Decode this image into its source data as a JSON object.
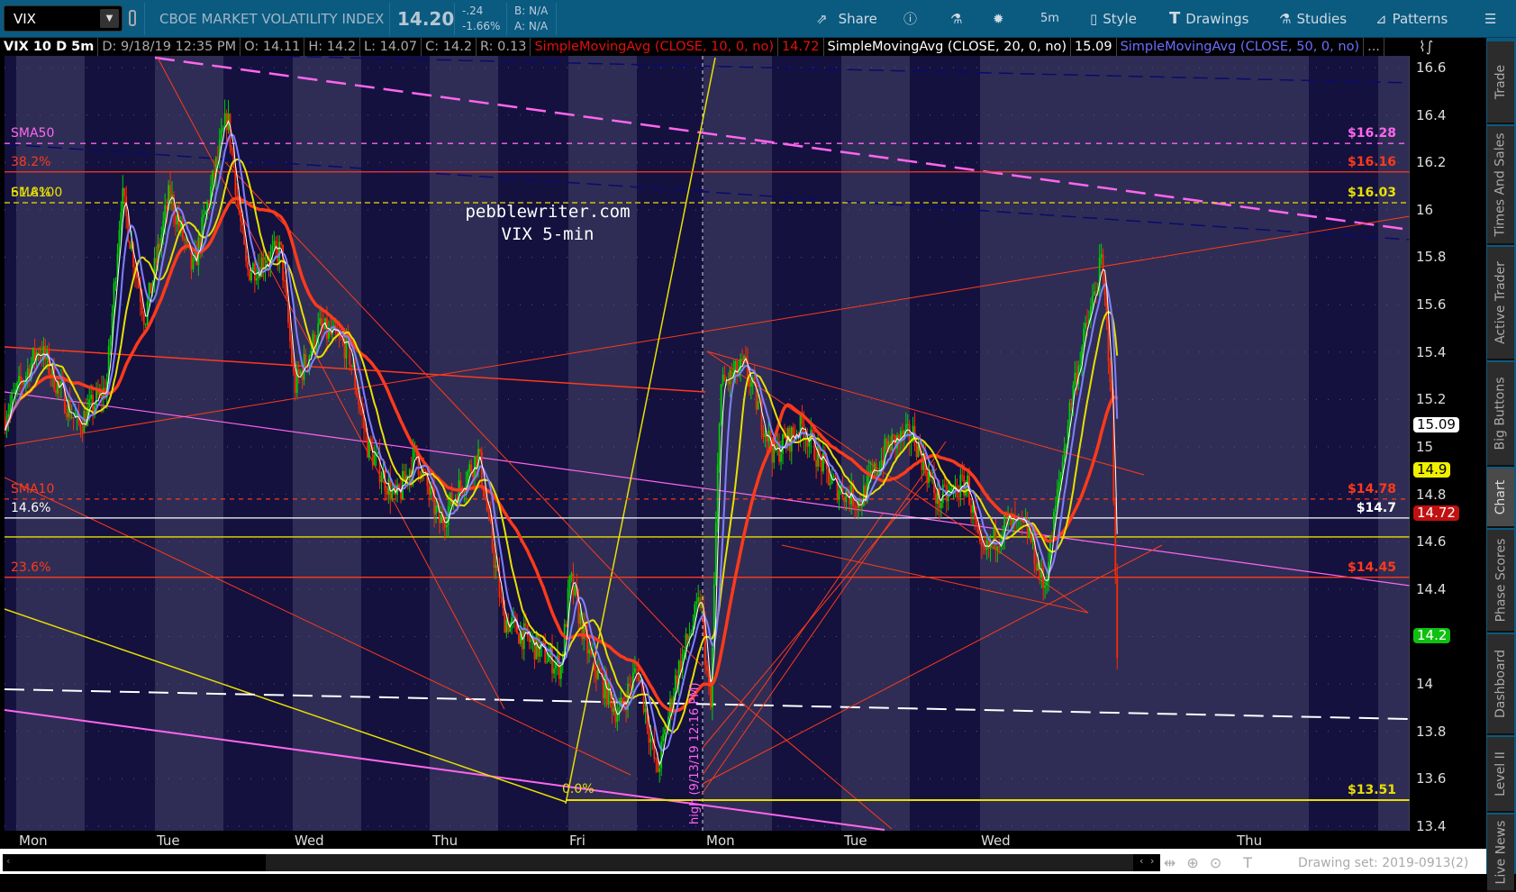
{
  "toolbar": {
    "symbol": "VIX",
    "description": "CBOE MARKET VOLATILITY INDEX",
    "last": "14.20",
    "change": "-.24",
    "change_pct": "-1.66%",
    "bid": "B: N/A",
    "ask": "A: N/A",
    "buttons": [
      {
        "label": "Share",
        "icon": "share-icon"
      },
      {
        "label": "",
        "icon": "info-icon"
      },
      {
        "label": "",
        "icon": "flask-icon"
      },
      {
        "label": "",
        "icon": "gear-icon"
      },
      {
        "label": "5m",
        "icon": ""
      },
      {
        "label": "Style",
        "icon": "candle-icon"
      },
      {
        "label": "Drawings",
        "icon": "text-t-icon"
      },
      {
        "label": "Studies",
        "icon": "flask-icon"
      },
      {
        "label": "Patterns",
        "icon": "patterns-icon"
      },
      {
        "label": "",
        "icon": "menu-icon"
      }
    ]
  },
  "info": {
    "title": "VIX 10 D 5m",
    "date": "D: 9/18/19 12:35 PM",
    "open": "O: 14.11",
    "high": "H: 14.2",
    "low": "L: 14.07",
    "close": "C: 14.2",
    "range": "R: 0.13",
    "sma10": "SimpleMovingAvg (CLOSE, 10, 0, no)",
    "sma10_val": "14.72",
    "sma20": "SimpleMovingAvg (CLOSE, 20, 0, no)",
    "sma20_val": "15.09",
    "sma50": "SimpleMovingAvg (CLOSE, 50, 0, no)",
    "more": "..."
  },
  "watermark": {
    "line1": "pebblewriter.com",
    "line2": "VIX 5-min"
  },
  "left_labels": [
    {
      "text": "SMA50",
      "color": "#ff66ee",
      "price": 16.28
    },
    {
      "text": "38.2%",
      "color": "#ff3a1a",
      "price": 16.16
    },
    {
      "text": "SMA100",
      "color": "#e8e000",
      "price": 16.03
    },
    {
      "text": "61.8%",
      "color": "#e8e000",
      "price": 16.03
    },
    {
      "text": "SMA10",
      "color": "#ff3a1a",
      "price": 14.78
    },
    {
      "text": "14.6%",
      "color": "#ffffff",
      "price": 14.7
    },
    {
      "text": "23.6%",
      "color": "#ff3a1a",
      "price": 14.45
    }
  ],
  "right_labels": [
    {
      "text": "$16.28",
      "color": "#ff66ee",
      "price": 16.28
    },
    {
      "text": "$16.16",
      "color": "#ff3a1a",
      "price": 16.16
    },
    {
      "text": "$16.03",
      "color": "#e8e000",
      "price": 16.03
    },
    {
      "text": "$14.78",
      "color": "#ff3a1a",
      "price": 14.78
    },
    {
      "text": "$14.7",
      "color": "#ffffff",
      "price": 14.7
    },
    {
      "text": "$14.45",
      "color": "#ff3a1a",
      "price": 14.45
    },
    {
      "text": "$13.51",
      "color": "#e8e000",
      "price": 13.51
    }
  ],
  "annotations": {
    "fib_zero": "0.0%",
    "high_note": "high (9/13/19 12:16 PM)"
  },
  "y_axis": {
    "ticks": [
      "16.6",
      "16.4",
      "16.2",
      "16",
      "15.8",
      "15.6",
      "15.4",
      "15.2",
      "15",
      "14.8",
      "14.6",
      "14.4",
      "14.2",
      "14",
      "13.8",
      "13.6",
      "13.4"
    ],
    "tags": [
      {
        "text": "15.09",
        "bg": "#ffffff",
        "fg": "#000000",
        "price": 15.09
      },
      {
        "text": "14.9",
        "bg": "#f0f000",
        "fg": "#000000",
        "price": 14.9
      },
      {
        "text": "14.72",
        "bg": "#c01010",
        "fg": "#ffffff",
        "price": 14.72
      },
      {
        "text": "14.2",
        "bg": "#10c010",
        "fg": "#ffffff",
        "price": 14.2
      }
    ]
  },
  "x_axis": [
    "Mon",
    "Tue",
    "Wed",
    "Thu",
    "Fri",
    "Mon",
    "Tue",
    "Wed",
    "Thu"
  ],
  "status": {
    "drawing_set": "Drawing set: 2019-0913(2)"
  },
  "sidebar": [
    "Trade",
    "Times And Sales",
    "Active Trader",
    "Big Buttons",
    "Chart",
    "Phase Scores",
    "Dashboard",
    "Level II",
    "Live News"
  ],
  "chart_data": {
    "type": "candlestick",
    "title": "VIX 10 D 5m",
    "ylim": [
      13.4,
      16.6
    ],
    "x_unit": "trading days from start",
    "price_path": [
      [
        0,
        15.13
      ],
      [
        0.25,
        15.42
      ],
      [
        0.53,
        15.09
      ],
      [
        0.74,
        15.25
      ],
      [
        0.85,
        16.07
      ],
      [
        1.02,
        15.54
      ],
      [
        1.2,
        16.07
      ],
      [
        1.37,
        15.74
      ],
      [
        1.62,
        16.4
      ],
      [
        1.76,
        15.74
      ],
      [
        2.01,
        15.83
      ],
      [
        2.11,
        15.25
      ],
      [
        2.29,
        15.5
      ],
      [
        2.5,
        15.42
      ],
      [
        2.64,
        15.01
      ],
      [
        2.85,
        14.77
      ],
      [
        2.99,
        14.97
      ],
      [
        3.17,
        14.68
      ],
      [
        3.45,
        14.97
      ],
      [
        3.63,
        14.28
      ],
      [
        3.8,
        14.19
      ],
      [
        4.05,
        14.07
      ],
      [
        4.12,
        14.44
      ],
      [
        4.26,
        14.11
      ],
      [
        4.47,
        13.87
      ],
      [
        4.61,
        14.07
      ],
      [
        4.75,
        13.62
      ],
      [
        4.89,
        14.03
      ],
      [
        5.07,
        14.36
      ],
      [
        5.14,
        13.87
      ],
      [
        5.21,
        15.25
      ],
      [
        5.39,
        15.34
      ],
      [
        5.6,
        14.97
      ],
      [
        5.81,
        15.09
      ],
      [
        6.02,
        14.85
      ],
      [
        6.23,
        14.77
      ],
      [
        6.44,
        15.01
      ],
      [
        6.62,
        15.05
      ],
      [
        6.8,
        14.77
      ],
      [
        7.01,
        14.85
      ],
      [
        7.11,
        14.52
      ],
      [
        7.29,
        14.68
      ],
      [
        7.46,
        14.64
      ],
      [
        7.57,
        14.4
      ],
      [
        7.78,
        15.25
      ],
      [
        7.99,
        15.78
      ],
      [
        8.06,
        15.25
      ],
      [
        8.1,
        14.15
      ]
    ]
  },
  "colors": {
    "up": "#00d000",
    "down": "#ff2a00",
    "bg_dark": "#14113f",
    "bg_light": "#2f2d55",
    "toolbar": "#0b5a80"
  }
}
